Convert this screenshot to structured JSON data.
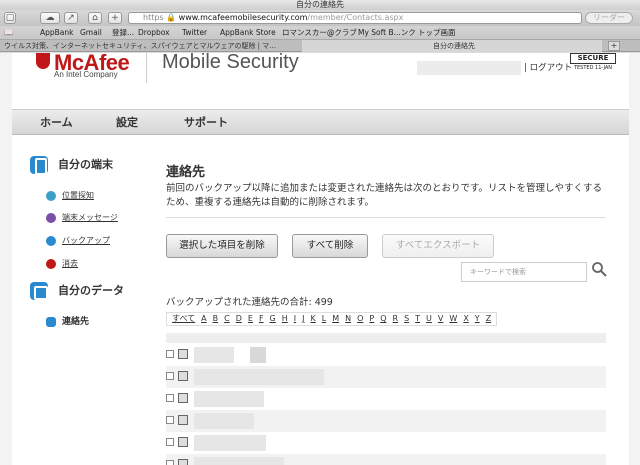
{
  "window": {
    "title": "自分の連絡先"
  },
  "toolbar": {
    "url_scheme": "https",
    "url_host": "www.mcafeemobilesecurity.com",
    "url_path": "/member/Contacts.aspx",
    "reader_label": "リーダー"
  },
  "bookmarks": [
    "AppBank",
    "Gmail",
    "登録...",
    "Dropbox",
    "Twitter",
    "AppBank Store",
    "ロマンスカー@クラブ",
    "My Soft B...ンク",
    "トップ画面"
  ],
  "tabs": [
    {
      "label": "ウイルス対策、インターネットセキュリティ、スパイウェアとマルウェアの駆除 | マ..."
    },
    {
      "label": "自分の連絡先"
    }
  ],
  "header": {
    "brand": "McAfee",
    "brand_sub": "An Intel Company",
    "product": "Mobile Security",
    "logout": "| ログアウト",
    "secure_badge": "SECURE",
    "secure_sub": "TESTED 11-JAN"
  },
  "nav": {
    "items": [
      "ホーム",
      "設定",
      "サポート"
    ]
  },
  "sidebar": {
    "section_device": "自分の端末",
    "device_links": [
      {
        "label": "位置探知",
        "color": "#3aa0c8"
      },
      {
        "label": "端末メッセージ",
        "color": "#7a4fa8"
      },
      {
        "label": "バックアップ",
        "color": "#2a8ad0"
      },
      {
        "label": "消去",
        "color": "#c01818"
      }
    ],
    "section_data": "自分のデータ",
    "contacts": "連絡先"
  },
  "main": {
    "title": "連絡先",
    "description": "前回のバックアップ以降に追加または変更された連絡先は次のとおりです。リストを管理しやすくするため、重複する連絡先は自動的に削除されます。",
    "buttons": {
      "delete_selected": "選択した項目を削除",
      "delete_all": "すべて削除",
      "export_all": "すべてエクスポート"
    },
    "search_placeholder": "キーワードで検索",
    "count_label": "バックアップされた連絡先の合計: 499",
    "alphabet": [
      "すべて",
      "A",
      "B",
      "C",
      "D",
      "E",
      "F",
      "G",
      "H",
      "I",
      "J",
      "K",
      "L",
      "M",
      "N",
      "O",
      "P",
      "Q",
      "R",
      "S",
      "T",
      "U",
      "V",
      "W",
      "X",
      "Y",
      "Z"
    ]
  },
  "colors": {
    "brand_red": "#c01818",
    "accent_blue": "#2a8ad0"
  }
}
